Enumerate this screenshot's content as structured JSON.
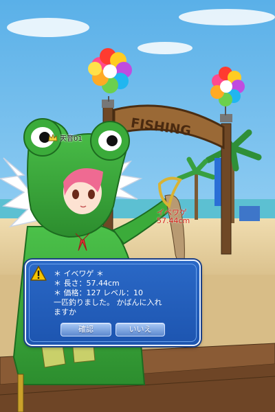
{
  "scene": {
    "sign_text": "FISHING",
    "player_name": "天音01",
    "catch_label": {
      "name": "イベワゲ",
      "length": "57.44cm"
    }
  },
  "dialog": {
    "lines": [
      "＊ イベワゲ ＊",
      "＊ 長さ：57.44cm",
      "＊ 価格：127 レベル：10",
      "一匹釣りました。 かばんに入れ",
      "ますか"
    ],
    "confirm_label": "確認",
    "cancel_label": "いいえ"
  },
  "colors": {
    "dialog_bg": "#2a68c6",
    "dialog_border": "#e8f1ff",
    "catch_label_text": "#d7241d",
    "frog_hood": "#3bab3a"
  },
  "icons": {
    "warning": "warning-icon",
    "crown": "crown-icon"
  }
}
